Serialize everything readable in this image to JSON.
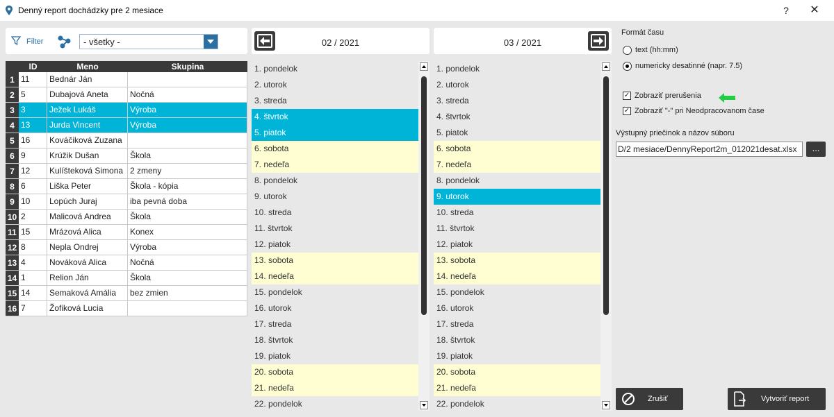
{
  "window": {
    "title": "Denný report dochádzky pre 2 mesiace",
    "help": "?",
    "close": "✕"
  },
  "filter": {
    "label": "Filter",
    "group_value": "- všetky -"
  },
  "employees": {
    "columns": [
      "ID",
      "Meno",
      "Skupina"
    ],
    "rows": [
      {
        "n": "1",
        "id": "11",
        "name": "Bednár Ján",
        "group": ""
      },
      {
        "n": "2",
        "id": "5",
        "name": "Dubajová Aneta",
        "group": "Nočná"
      },
      {
        "n": "3",
        "id": "3",
        "name": "Ježek Lukáš",
        "group": "Výroba"
      },
      {
        "n": "4",
        "id": "13",
        "name": "Jurda Vincent",
        "group": "Výroba"
      },
      {
        "n": "5",
        "id": "16",
        "name": "Kováčiková Zuzana",
        "group": ""
      },
      {
        "n": "6",
        "id": "9",
        "name": "Krúžik Dušan",
        "group": "Škola"
      },
      {
        "n": "7",
        "id": "12",
        "name": "Kulíšteková Simona",
        "group": "2 zmeny"
      },
      {
        "n": "8",
        "id": "6",
        "name": "Liška Peter",
        "group": "Škola - kópia"
      },
      {
        "n": "9",
        "id": "10",
        "name": "Lopúch Juraj",
        "group": "iba pevná doba"
      },
      {
        "n": "10",
        "id": "2",
        "name": "Malicová Andrea",
        "group": "Škola"
      },
      {
        "n": "11",
        "id": "15",
        "name": "Mrázová Alica",
        "group": "Konex"
      },
      {
        "n": "12",
        "id": "8",
        "name": "Nepla Ondrej",
        "group": "Výroba"
      },
      {
        "n": "13",
        "id": "4",
        "name": "Nováková Alica",
        "group": "Nočná"
      },
      {
        "n": "14",
        "id": "1",
        "name": "Relion Ján",
        "group": "Škola"
      },
      {
        "n": "15",
        "id": "14",
        "name": "Semaková Amália",
        "group": "bez zmien"
      },
      {
        "n": "16",
        "id": "7",
        "name": "Žofiková Lucia",
        "group": ""
      }
    ]
  },
  "month1": {
    "label": "02 / 2021",
    "days": [
      "1. pondelok",
      "2. utorok",
      "3. streda",
      "4. štvrtok",
      "5. piatok",
      "6. sobota",
      "7. nedeľa",
      "8. pondelok",
      "9. utorok",
      "10. streda",
      "11. štvrtok",
      "12. piatok",
      "13. sobota",
      "14. nedeľa",
      "15. pondelok",
      "16. utorok",
      "17. streda",
      "18. štvrtok",
      "19. piatok",
      "20. sobota",
      "21. nedeľa",
      "22. pondelok"
    ]
  },
  "month2": {
    "label": "03 / 2021",
    "days": [
      "1. pondelok",
      "2. utorok",
      "3. streda",
      "4. štvrtok",
      "5. piatok",
      "6. sobota",
      "7. nedeľa",
      "8. pondelok",
      "9. utorok",
      "10. streda",
      "11. štvrtok",
      "12. piatok",
      "13. sobota",
      "14. nedeľa",
      "15. pondelok",
      "16. utorok",
      "17. streda",
      "18. štvrtok",
      "19. piatok",
      "20. sobota",
      "21. nedeľa",
      "22. pondelok"
    ]
  },
  "options": {
    "format_title": "Formát času",
    "radio_text": "text (hh:mm)",
    "radio_numeric": "numericky desatinné (napr. 7.5)",
    "chk_breaks": "Zobraziť prerušenia",
    "chk_dash": "Zobraziť \"-\" pri Neodpracovanom čase",
    "path_label": "Výstupný priečinok a názov súboru",
    "path_value": "D/2 mesiace/DennyReport2m_012021desat.xlsx",
    "browse": "...",
    "cancel": "Zrušiť",
    "create": "Vytvoriť report"
  },
  "colors": {
    "selection": "#00b4d8",
    "weekend": "#fefed2",
    "dark": "#3a3a3a",
    "arrow": "#22cc44"
  }
}
